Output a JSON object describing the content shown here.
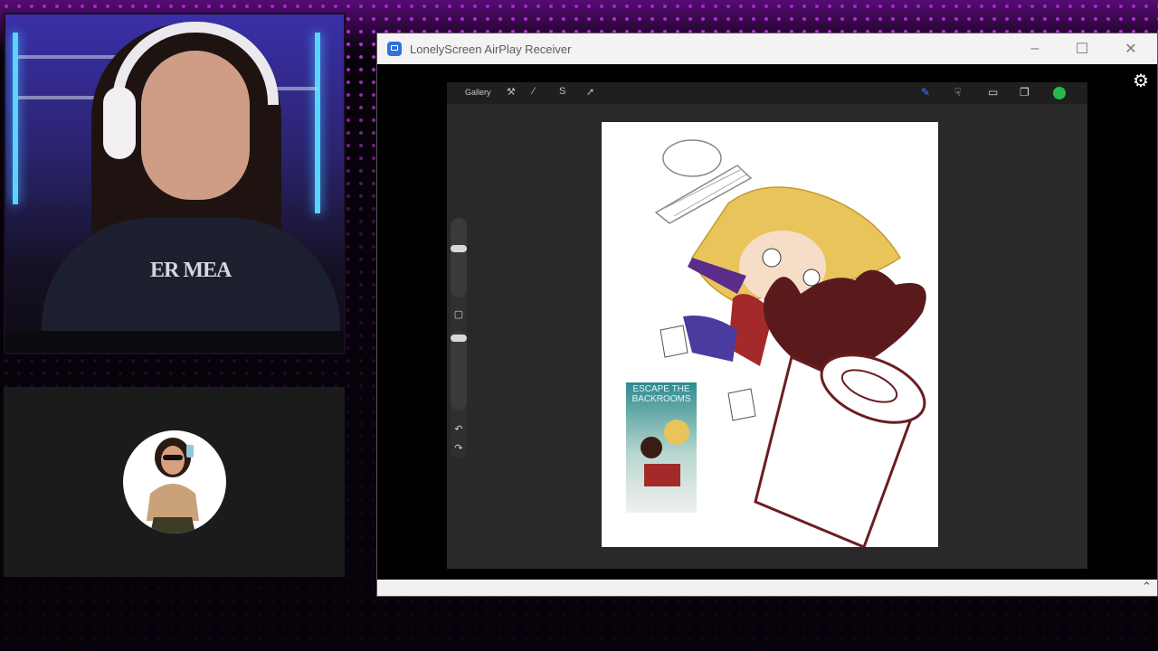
{
  "window": {
    "title": "LonelyScreen AirPlay Receiver",
    "minimize_icon": "minimize-icon",
    "maximize_icon": "maximize-icon",
    "close_icon": "close-icon",
    "settings_icon": "gear-icon"
  },
  "procreate": {
    "gallery_label": "Gallery",
    "left_tools": [
      "wrench-icon",
      "magic-wand-icon",
      "selection-icon",
      "transform-icon"
    ],
    "right_tools": [
      "brush-icon",
      "smudge-icon",
      "eraser-icon",
      "layers-icon"
    ],
    "current_color": "#27b84b",
    "sidebar": [
      "brush-size-slider",
      "modify-button",
      "opacity-slider",
      "undo-button",
      "redo-button"
    ]
  },
  "canvas": {
    "reference_title": "ESCAPE THE BACKROOMS"
  },
  "colors": {
    "accent_purple": "#b418e8",
    "heart": "#5a1a1c",
    "hair": "#e8c45a"
  }
}
